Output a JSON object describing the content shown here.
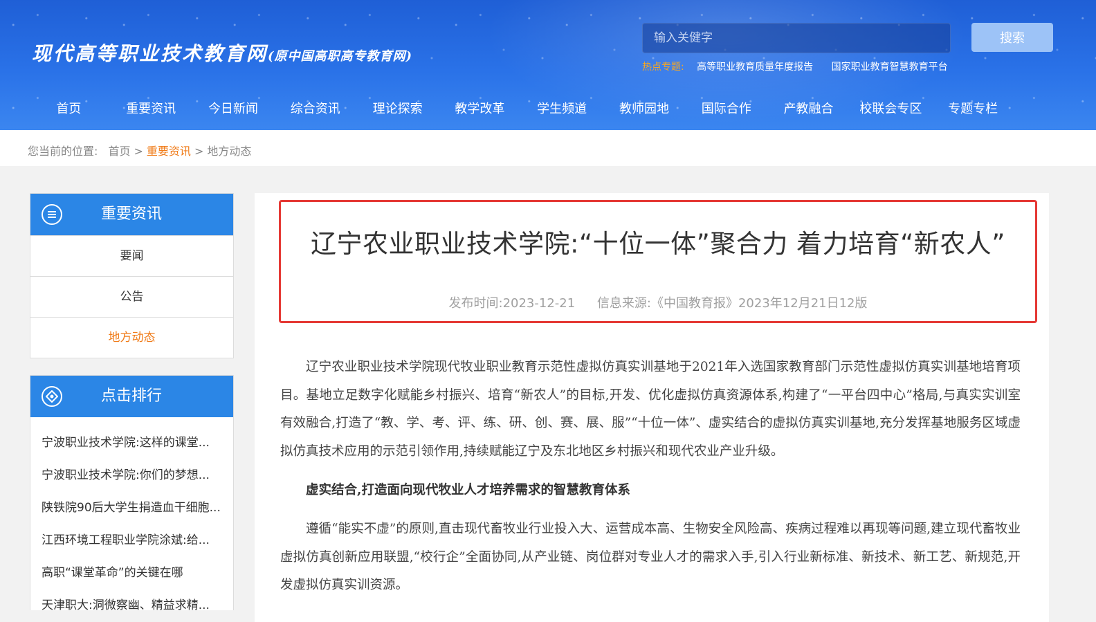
{
  "header": {
    "logo_main": "现代高等职业技术教育网",
    "logo_sub": "(原中国高职高专教育网)",
    "search_placeholder": "输入关健字",
    "search_button": "搜索",
    "hot_label": "热点专题:",
    "hot_links": [
      "高等职业教育质量年度报告",
      "国家职业教育智慧教育平台"
    ]
  },
  "nav": [
    "首页",
    "重要资讯",
    "今日新闻",
    "综合资讯",
    "理论探索",
    "教学改革",
    "学生频道",
    "教师园地",
    "国际合作",
    "产教融合",
    "校联会专区",
    "专题专栏"
  ],
  "breadcrumb": {
    "prefix": "您当前的位置:",
    "items": [
      "首页",
      "重要资讯",
      "地方动态"
    ],
    "sep": ">"
  },
  "sidebar": {
    "section_title": "重要资讯",
    "menu": [
      "要闻",
      "公告",
      "地方动态"
    ],
    "rank_title": "点击排行",
    "rank_items": [
      "宁波职业技术学院:这样的课堂...",
      "宁波职业技术学院:你们的梦想...",
      "陕铁院90后大学生捐造血干细胞...",
      "江西环境工程职业学院涂斌:给...",
      "高职“课堂革命”的关键在哪",
      "天津职大:洞微察幽、精益求精..."
    ]
  },
  "article": {
    "title": "辽宁农业职业技术学院:“十位一体”聚合力 着力培育“新农人”",
    "publish_label": "发布时间:",
    "publish_date": "2023-12-21",
    "source_label": "信息来源:",
    "source": "《中国教育报》2023年12月21日12版",
    "para1": "辽宁农业职业技术学院现代牧业职业教育示范性虚拟仿真实训基地于2021年入选国家教育部门示范性虚拟仿真实训基地培育项目。基地立足数字化赋能乡村振兴、培育“新农人”的目标,开发、优化虚拟仿真资源体系,构建了“一平台四中心”格局,与真实实训室有效融合,打造了“教、学、考、评、练、研、创、赛、展、服”“十位一体”、虚实结合的虚拟仿真实训基地,充分发挥基地服务区域虚拟仿真技术应用的示范引领作用,持续赋能辽宁及东北地区乡村振兴和现代农业产业升级。",
    "subhead1": "虚实结合,打造面向现代牧业人才培养需求的智慧教育体系",
    "para2": "遵循“能实不虚”的原则,直击现代畜牧业行业投入大、运营成本高、生物安全风险高、疾病过程难以再现等问题,建立现代畜牧业虚拟仿真创新应用联盟,“校行企”全面协同,从产业链、岗位群对专业人才的需求入手,引入行业新标准、新技术、新工艺、新规范,开发虚拟仿真实训资源。"
  }
}
